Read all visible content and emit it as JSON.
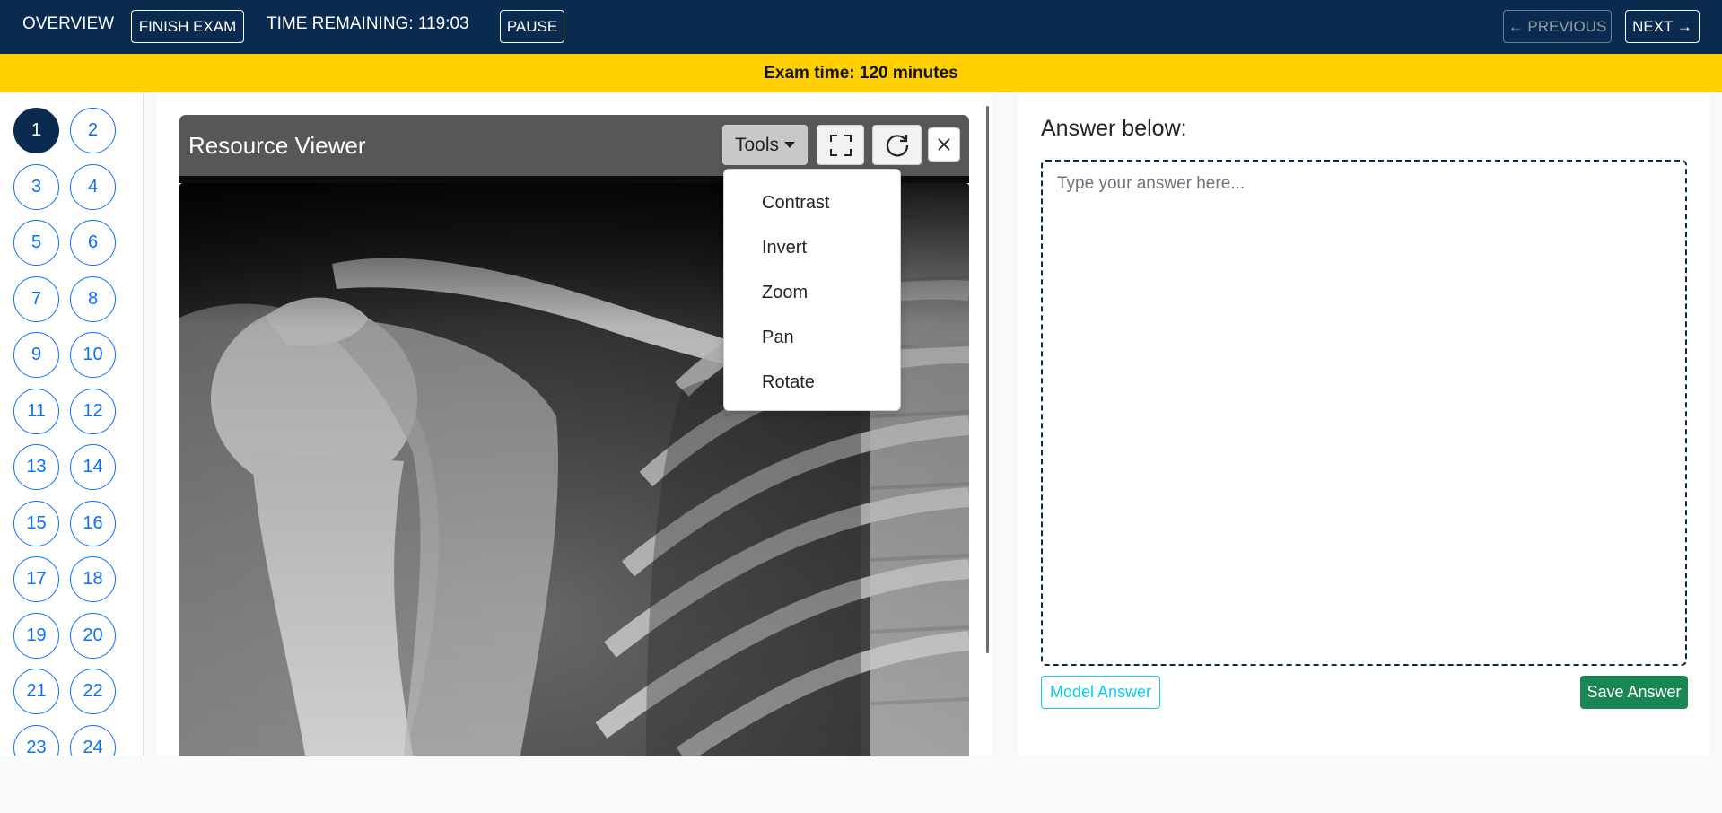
{
  "topbar": {
    "overview": "OVERVIEW",
    "finish_exam": "FINISH EXAM",
    "time_remaining": "TIME REMAINING: 119:03",
    "pause": "PAUSE",
    "previous": "← PREVIOUS",
    "next": "NEXT →"
  },
  "banner": {
    "text": "Exam time: 120 minutes"
  },
  "questions": [
    "1",
    "2",
    "3",
    "4",
    "5",
    "6",
    "7",
    "8",
    "9",
    "10",
    "11",
    "12",
    "13",
    "14",
    "15",
    "16",
    "17",
    "18",
    "19",
    "20",
    "21",
    "22",
    "23",
    "24"
  ],
  "current_question": "1",
  "viewer": {
    "title": "Resource Viewer",
    "tools_label": "Tools",
    "tools_menu": [
      "Contrast",
      "Invert",
      "Zoom",
      "Pan",
      "Rotate"
    ],
    "icons": [
      "fullscreen-icon",
      "reset-icon",
      "close-icon"
    ]
  },
  "answer": {
    "label": "Answer below:",
    "placeholder": "Type your answer here...",
    "model_answer": "Model Answer",
    "save_answer": "Save Answer"
  },
  "colors": {
    "navy": "#0a2a4f",
    "banner_yellow": "#ffcf00",
    "link_blue": "#0d6efd",
    "save_green": "#198754",
    "info_cyan": "#0dcaf0"
  }
}
